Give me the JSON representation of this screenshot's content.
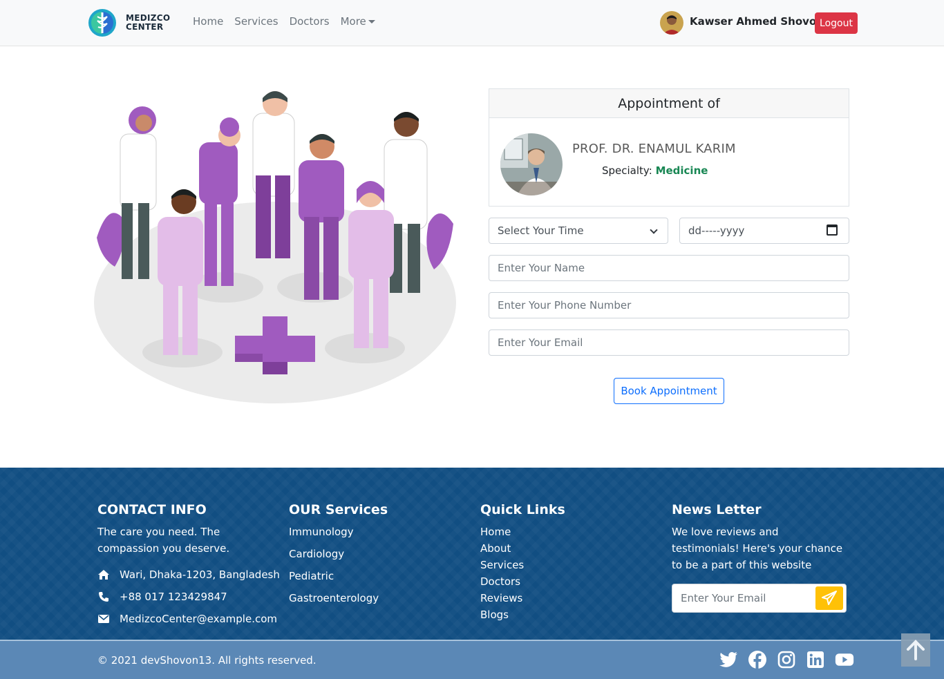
{
  "navbar": {
    "brand_line1": "MEDIZCO",
    "brand_line2": "CENTER",
    "links": [
      "Home",
      "Services",
      "Doctors",
      "More"
    ],
    "user_name": "Kawser Ahmed Shovon",
    "logout_label": "Logout"
  },
  "appointment": {
    "header": "Appointment of",
    "doctor_name": "PROF. DR. ENAMUL KARIM",
    "specialty_label": "Specialty:",
    "specialty_value": "Medicine"
  },
  "form": {
    "time_select_value": "Select Your Time",
    "date_placeholder": "dd-----yyyy",
    "name_placeholder": "Enter Your Name",
    "phone_placeholder": "Enter Your Phone Number",
    "email_placeholder": "Enter Your Email",
    "submit_label": "Book Appointment"
  },
  "footer": {
    "contact": {
      "heading": "CONTACT INFO",
      "tagline": "The care you need. The compassion you deserve.",
      "address": "Wari, Dhaka-1203, Bangladesh",
      "phone": "+88 017 123429847",
      "email": "MedizcoCenter@example.com"
    },
    "services": {
      "heading": "OUR Services",
      "items": [
        "Immunology",
        "Cardiology",
        "Pediatric",
        "Gastroenterology"
      ]
    },
    "quick_links": {
      "heading": "Quick Links",
      "items": [
        "Home",
        "About",
        "Services",
        "Doctors",
        "Reviews",
        "Blogs"
      ]
    },
    "newsletter": {
      "heading": "News Letter",
      "text": "We love reviews and testimonials! Here's your chance to be a part of this website",
      "email_placeholder": "Enter Your Email"
    },
    "copyright": "© 2021 devShovon13. All rights reserved.",
    "socials": [
      "twitter-icon",
      "facebook-icon",
      "instagram-icon",
      "linkedin-icon",
      "youtube-icon"
    ]
  },
  "colors": {
    "footer_bg": "#114e82",
    "bottom_bar": "#5b88b6",
    "logout": "#dc3545",
    "primary": "#0d6efd",
    "specialty": "#198754",
    "send_button": "#ffc107",
    "illustration_purple": "#a05bbf"
  }
}
